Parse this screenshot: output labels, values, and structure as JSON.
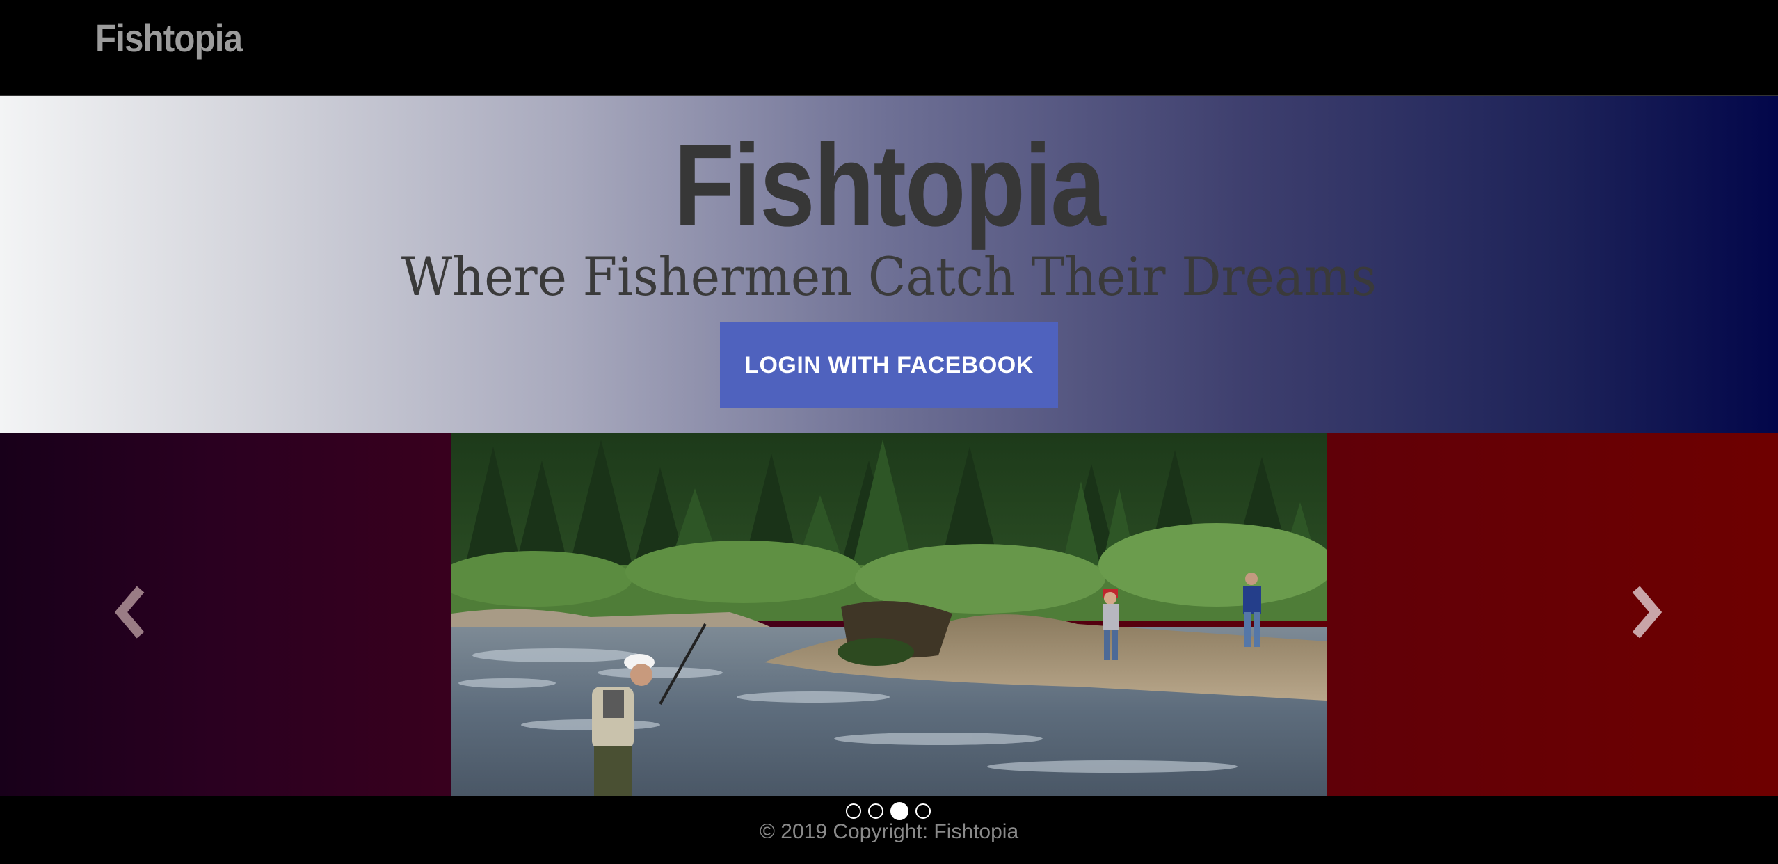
{
  "navbar": {
    "brand": "Fishtopia"
  },
  "hero": {
    "title": "Fishtopia",
    "subtitle": "Where Fishermen Catch Their Dreams",
    "login_button": "LOGIN WITH FACEBOOK"
  },
  "carousel": {
    "prev_icon": "chevron-left-icon",
    "next_icon": "chevron-right-icon",
    "slide_count": 4,
    "active_index": 2
  },
  "footer": {
    "copyright": "© 2019 Copyright: Fishtopia"
  },
  "colors": {
    "button": "#4f62be",
    "hero_gradient_start": "#f3f4f5",
    "hero_gradient_end": "#02064a",
    "carousel_left": "#18001a",
    "carousel_right": "#6e0000"
  }
}
